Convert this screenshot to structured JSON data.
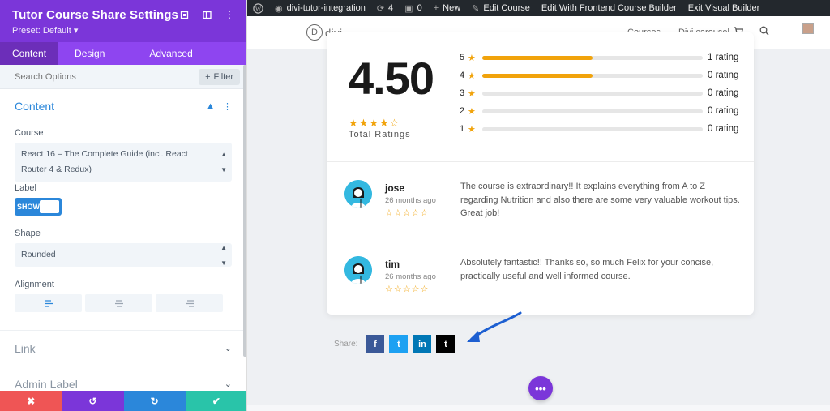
{
  "panel": {
    "title": "Tutor Course Share Settings",
    "preset": "Preset: Default ▾",
    "tabs": [
      {
        "label": "Content",
        "active": true
      },
      {
        "label": "Design",
        "active": false
      },
      {
        "label": "Advanced",
        "active": false
      }
    ],
    "search_placeholder": "Search Options",
    "filter_label": "Filter",
    "content_section": {
      "title": "Content",
      "course_label": "Course",
      "course_value": "React 16 – The Complete Guide (incl. React Router 4 & Redux)",
      "label_label": "Label",
      "toggle_text": "SHOW",
      "shape_label": "Shape",
      "shape_value": "Rounded",
      "alignment_label": "Alignment"
    },
    "link_section": "Link",
    "admin_label_section": "Admin Label",
    "footer_colors": [
      "#ef5555",
      "#7b36d9",
      "#2b87da",
      "#29c4a9"
    ]
  },
  "adminbar": {
    "site": "divi-tutor-integration",
    "updates": "4",
    "comments": "0",
    "new": "New",
    "edit_course": "Edit Course",
    "frontend_builder": "Edit With Frontend Course Builder",
    "exit_builder": "Exit Visual Builder"
  },
  "site": {
    "logo": "divi",
    "logo_letter": "D",
    "nav": [
      "Courses",
      "Divi carousel"
    ]
  },
  "ratings": {
    "average": "4.50",
    "average_stars": 4,
    "total_label": "Total Ratings",
    "rows": [
      {
        "star": "5",
        "fill": 0.5,
        "label": "1 rating"
      },
      {
        "star": "4",
        "fill": 0.5,
        "label": "0 rating"
      },
      {
        "star": "3",
        "fill": 0,
        "label": "0 rating"
      },
      {
        "star": "2",
        "fill": 0,
        "label": "0 rating"
      },
      {
        "star": "1",
        "fill": 0,
        "label": "0 rating"
      }
    ]
  },
  "reviews": [
    {
      "name": "jose",
      "date": "26 months ago",
      "text": "The course is extraordinary!! It explains everything from A to Z regarding Nutrition and also there are some very valuable workout tips. Great job!"
    },
    {
      "name": "tim",
      "date": "26 months ago",
      "text": "Absolutely fantastic!! Thanks so, so much Felix for your concise, practically useful and well informed course."
    }
  ],
  "share": {
    "label": "Share:",
    "buttons": [
      {
        "name": "facebook",
        "glyph": "f",
        "color": "#3b5998"
      },
      {
        "name": "twitter",
        "glyph": "t",
        "color": "#1da1f2"
      },
      {
        "name": "linkedin",
        "glyph": "in",
        "color": "#0077b5"
      },
      {
        "name": "tumblr",
        "glyph": "t",
        "color": "#000000"
      }
    ]
  },
  "colors": {
    "accent": "#7b36d9",
    "blue": "#2b87da",
    "star": "#f1a30b"
  }
}
